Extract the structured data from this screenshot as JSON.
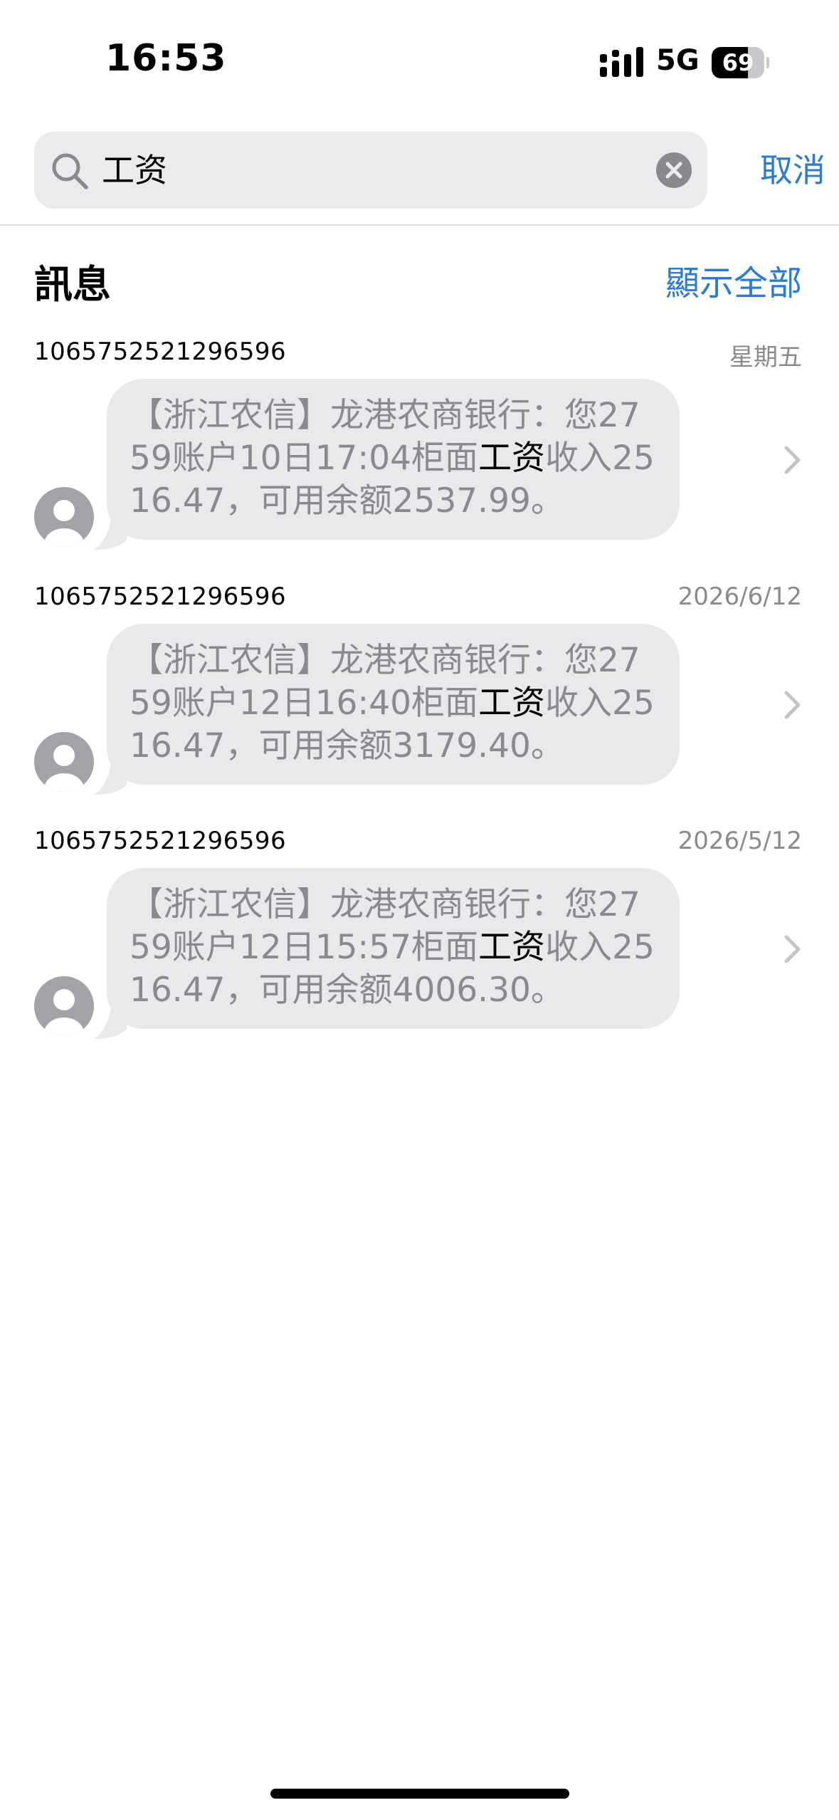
{
  "status": {
    "time": "16:53",
    "network": "5G",
    "battery_level": "69",
    "battery_fraction": 0.69
  },
  "search": {
    "query": "工资",
    "cancel_label": "取消"
  },
  "section": {
    "title": "訊息",
    "show_all_label": "顯示全部"
  },
  "results": [
    {
      "sender": "1065752521296596",
      "date": "星期五",
      "text_before": "【浙江农信】龙港农商银行：您2759账户10日17:04柜面",
      "highlight": "工资",
      "text_after": "收入2516.47，可用余额2537.99。"
    },
    {
      "sender": "1065752521296596",
      "date": "2026/6/12",
      "text_before": "【浙江农信】龙港农商银行：您2759账户12日16:40柜面",
      "highlight": "工资",
      "text_after": "收入2516.47，可用余额3179.40。"
    },
    {
      "sender": "1065752521296596",
      "date": "2026/5/12",
      "text_before": "【浙江农信】龙港农商银行：您2759账户12日15:57柜面",
      "highlight": "工资",
      "text_after": "收入2516.47，可用余额4006.30。"
    }
  ],
  "icons": {
    "search": "search-icon",
    "clear": "clear-icon",
    "avatar": "avatar-icon",
    "chevron": "chevron-right-icon",
    "signal": "signal-icon"
  },
  "colors": {
    "accent": "#2a7bd6",
    "bubble": "#e9e9eb",
    "secondary_text": "#8a8a8e",
    "search_field": "#ebebed"
  }
}
